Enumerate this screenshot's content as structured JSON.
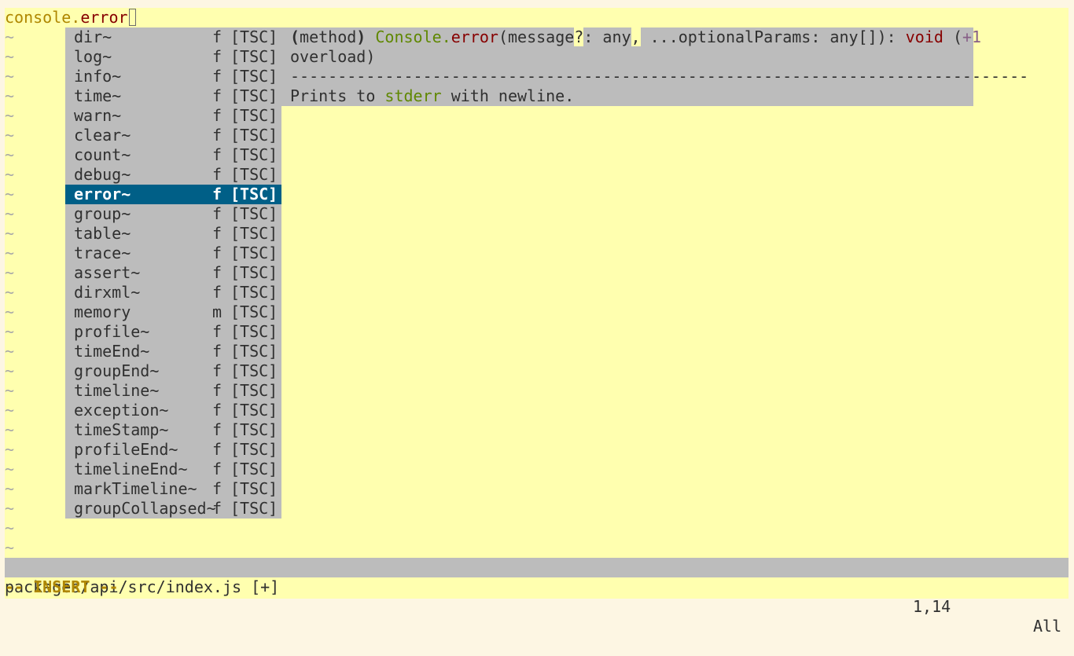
{
  "editor": {
    "line1": {
      "object": "console",
      "dot": ".",
      "method": "error"
    },
    "tilde": "~"
  },
  "popup": {
    "items": [
      {
        "word": "dir~",
        "kind": "f",
        "menu": "[TSC]"
      },
      {
        "word": "log~",
        "kind": "f",
        "menu": "[TSC]"
      },
      {
        "word": "info~",
        "kind": "f",
        "menu": "[TSC]"
      },
      {
        "word": "time~",
        "kind": "f",
        "menu": "[TSC]"
      },
      {
        "word": "warn~",
        "kind": "f",
        "menu": "[TSC]"
      },
      {
        "word": "clear~",
        "kind": "f",
        "menu": "[TSC]"
      },
      {
        "word": "count~",
        "kind": "f",
        "menu": "[TSC]"
      },
      {
        "word": "debug~",
        "kind": "f",
        "menu": "[TSC]"
      },
      {
        "word": "error~",
        "kind": "f",
        "menu": "[TSC]",
        "selected": true
      },
      {
        "word": "group~",
        "kind": "f",
        "menu": "[TSC]"
      },
      {
        "word": "table~",
        "kind": "f",
        "menu": "[TSC]"
      },
      {
        "word": "trace~",
        "kind": "f",
        "menu": "[TSC]"
      },
      {
        "word": "assert~",
        "kind": "f",
        "menu": "[TSC]"
      },
      {
        "word": "dirxml~",
        "kind": "f",
        "menu": "[TSC]"
      },
      {
        "word": "memory",
        "kind": "m",
        "menu": "[TSC]"
      },
      {
        "word": "profile~",
        "kind": "f",
        "menu": "[TSC]"
      },
      {
        "word": "timeEnd~",
        "kind": "f",
        "menu": "[TSC]"
      },
      {
        "word": "groupEnd~",
        "kind": "f",
        "menu": "[TSC]"
      },
      {
        "word": "timeline~",
        "kind": "f",
        "menu": "[TSC]"
      },
      {
        "word": "exception~",
        "kind": "f",
        "menu": "[TSC]"
      },
      {
        "word": "timeStamp~",
        "kind": "f",
        "menu": "[TSC]"
      },
      {
        "word": "profileEnd~",
        "kind": "f",
        "menu": "[TSC]"
      },
      {
        "word": "timelineEnd~",
        "kind": "f",
        "menu": "[TSC]"
      },
      {
        "word": "markTimeline~",
        "kind": "f",
        "menu": "[TSC]"
      },
      {
        "word": "groupCollapsed~",
        "kind": "f",
        "menu": "[TSC]"
      }
    ]
  },
  "preview": {
    "paren_open": "(",
    "method_tag": "method",
    "paren_close": ")",
    "class_name": "Console",
    "dot": ".",
    "fn_name": "error",
    "sig_open": "(message",
    "question": "?",
    "sig_mid": ": any",
    "comma": ",",
    "sig_rest": " ...optionalParams: any[]): ",
    "return_type": "void",
    "overload_open": "(",
    "overload_hint": "+1",
    "overload_line2": "overload)",
    "separator": "------------------------------------------------------------------------------",
    "doc_prefix": "Prints to ",
    "doc_code": "stderr",
    "doc_suffix": " with newline."
  },
  "status": {
    "file": "packages/api/src/index.js [+]",
    "position": "1,14",
    "scroll": "All"
  },
  "mode": "-- INSERT --",
  "colors": {
    "background": "#ffffaf",
    "popup_bg": "#bcbcbc",
    "selected_bg": "#005f87",
    "mode_fg": "#af8700"
  }
}
